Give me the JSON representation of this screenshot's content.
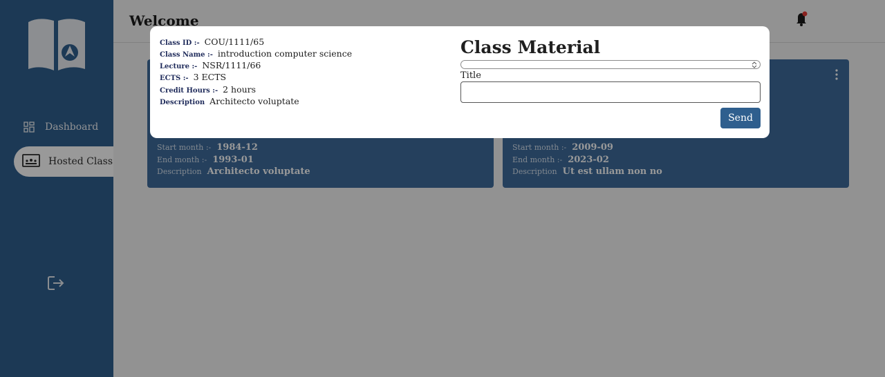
{
  "sidebar": {
    "items": [
      {
        "label": "Dashboard",
        "icon": "dashboard-icon"
      },
      {
        "label": "Hosted Class",
        "icon": "hosted-class-icon"
      }
    ],
    "logout_icon": "logout-icon"
  },
  "header": {
    "title": "Welcome",
    "notification_icon": "bell-icon",
    "notification_badge_color": "#e53935"
  },
  "cards": [
    {
      "rows": [
        {
          "label": "Start month :-",
          "value": "1984-12"
        },
        {
          "label": "End month :-",
          "value": "1993-01"
        },
        {
          "label": "Description",
          "value": "Architecto voluptate"
        }
      ]
    },
    {
      "rows": [
        {
          "label": "Start month :-",
          "value": "2009-09"
        },
        {
          "label": "End month :-",
          "value": "2023-02"
        },
        {
          "label": "Description",
          "value": "Ut est ullam non no"
        }
      ]
    }
  ],
  "modal": {
    "info": [
      {
        "label": "Class ID :-",
        "value": "COU/1111/65"
      },
      {
        "label": "Class Name :-",
        "value": "introduction computer science"
      },
      {
        "label": "Lecture :-",
        "value": "NSR/1111/66"
      },
      {
        "label": "ECTS :-",
        "value": "3 ECTS"
      },
      {
        "label": "Credit Hours :-",
        "value": "2 hours"
      },
      {
        "label": "Description",
        "value": "Architecto voluptate"
      }
    ],
    "title": "Class Material",
    "select_value": "",
    "title_label": "Title",
    "title_input_value": "",
    "send_label": "Send"
  },
  "colors": {
    "sidebar": "#2f5f8e",
    "card": "#3e6c9c",
    "button": "#2f5f8e"
  }
}
